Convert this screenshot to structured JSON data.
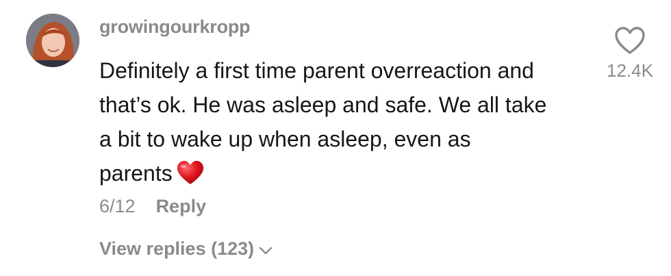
{
  "comment": {
    "username": "growingourkropp",
    "text_lines": [
      "Definitely a first time parent overreaction and",
      "that’s ok. He was asleep and safe. We all take",
      "a bit to wake up when asleep, even as",
      "parents"
    ],
    "emoji_icon": "red-heart-emoji",
    "date": "6/12",
    "reply_label": "Reply",
    "view_replies_label": "View replies (123)",
    "like_count": "12.4K"
  },
  "colors": {
    "muted_text": "#8a8a8a",
    "body_text": "#161616",
    "heart_red": "#e0131e"
  }
}
